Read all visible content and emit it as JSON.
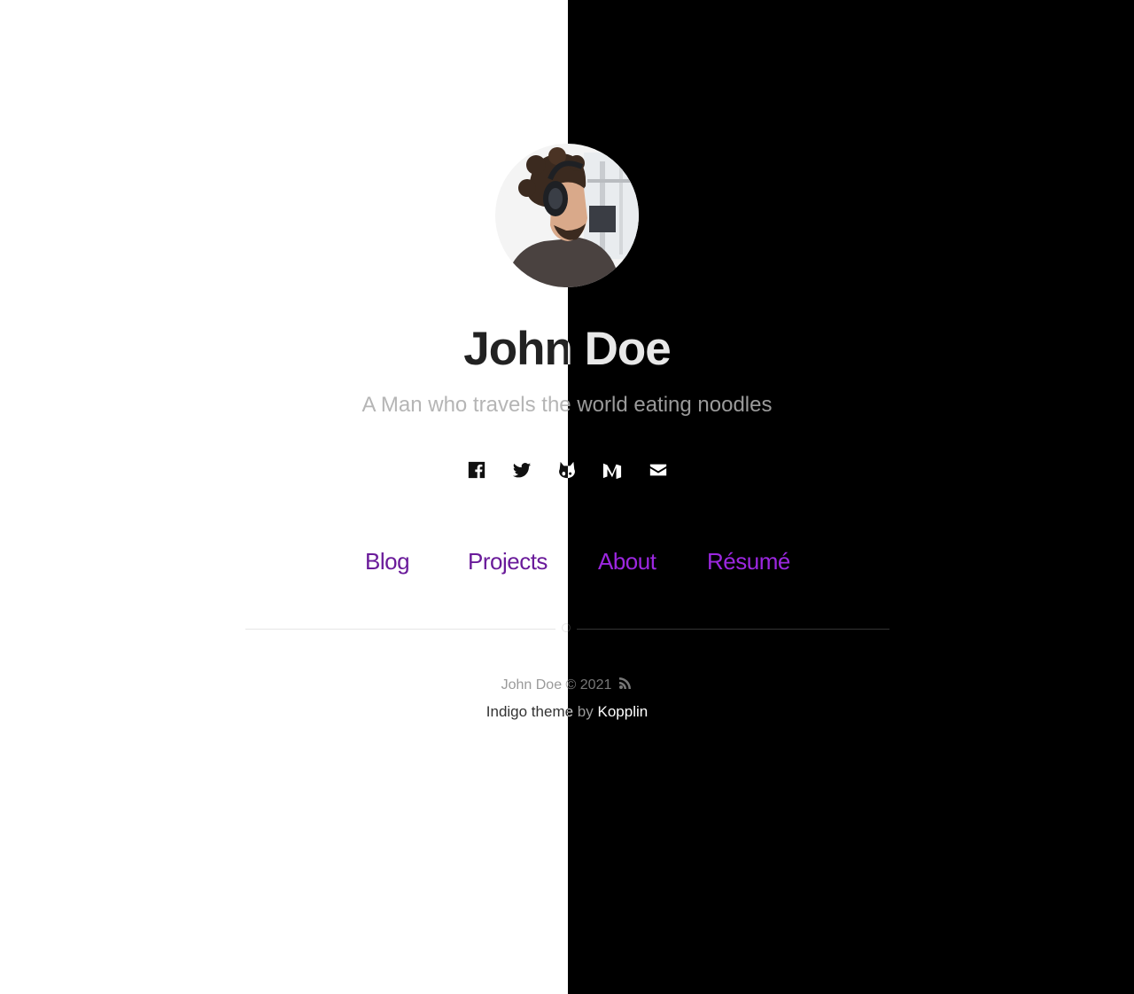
{
  "profile": {
    "name": "John Doe",
    "tagline": "A Man who travels the world eating noodles",
    "avatar_alt": "profile photo of man wearing headphones"
  },
  "social": [
    {
      "icon": "facebook-icon",
      "label": "Facebook"
    },
    {
      "icon": "twitter-icon",
      "label": "Twitter"
    },
    {
      "icon": "github-icon",
      "label": "GitHub"
    },
    {
      "icon": "medium-icon",
      "label": "Medium"
    },
    {
      "icon": "email-icon",
      "label": "Email"
    }
  ],
  "nav": {
    "items": [
      {
        "label": "Blog"
      },
      {
        "label": "Projects"
      },
      {
        "label": "About"
      },
      {
        "label": "Résumé"
      }
    ]
  },
  "footer": {
    "copyright": "John Doe © 2021",
    "rss_icon": "rss-icon",
    "theme_text": "Indigo theme",
    "by_text": "by",
    "author_link": "Kopplin"
  },
  "colors": {
    "light_background": "#ffffff",
    "dark_background": "#000000",
    "nav_link_light": "#6a1b9a",
    "nav_link_dark": "#9c27e0"
  }
}
